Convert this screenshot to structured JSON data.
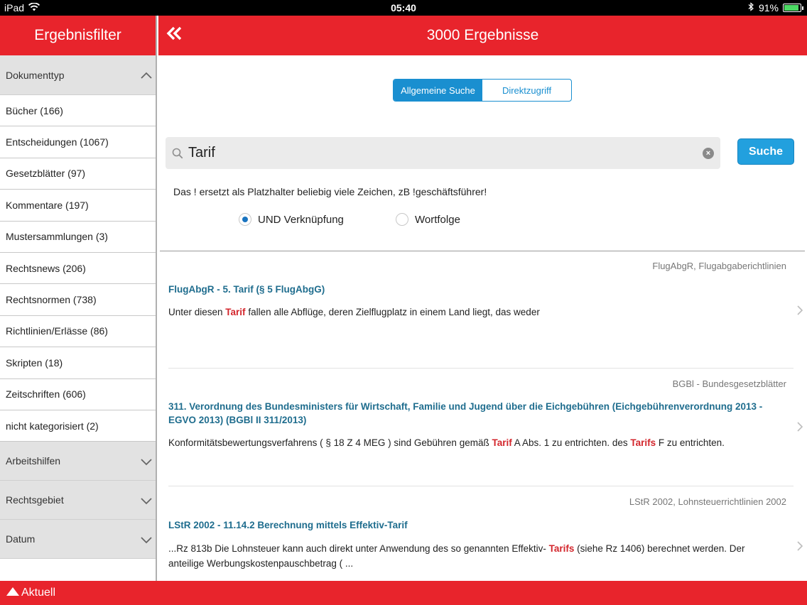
{
  "status": {
    "device": "iPad",
    "time": "05:40",
    "battery": "91%",
    "battery_level": 0.91
  },
  "sidebar": {
    "title": "Ergebnisfilter",
    "document_type": {
      "label": "Dokumenttyp",
      "items": [
        {
          "label": "Bücher (166)"
        },
        {
          "label": "Entscheidungen (1067)"
        },
        {
          "label": "Gesetzblätter (97)"
        },
        {
          "label": "Kommentare (197)"
        },
        {
          "label": "Mustersammlungen (3)"
        },
        {
          "label": "Rechtsnews (206)"
        },
        {
          "label": "Rechtsnormen (738)"
        },
        {
          "label": "Richtlinien/Erlässe (86)"
        },
        {
          "label": "Skripten (18)"
        },
        {
          "label": "Zeitschriften (606)"
        },
        {
          "label": "nicht kategorisiert (2)"
        }
      ]
    },
    "sections": [
      {
        "label": "Arbeitshilfen"
      },
      {
        "label": "Rechtsgebiet"
      },
      {
        "label": "Datum"
      }
    ]
  },
  "main": {
    "title": "3000 Ergebnisse",
    "tabs": [
      {
        "label": "Allgemeine Suche",
        "active": true
      },
      {
        "label": "Direktzugriff",
        "active": false
      }
    ],
    "search": {
      "value": "Tarif",
      "button_label": "Suche",
      "hint": "Das ! ersetzt als Platzhalter beliebig viele Zeichen, zB !geschäftsführer!"
    },
    "options": [
      {
        "label": "UND Verknüpfung",
        "selected": true
      },
      {
        "label": "Wortfolge",
        "selected": false
      }
    ],
    "results": [
      {
        "source": "FlugAbgR, Flugabgaberichtlinien",
        "title": "FlugAbgR - 5. Tarif (§ 5 FlugAbgG)",
        "snippet": [
          {
            "text": "Unter diesen "
          },
          {
            "text": "Tarif",
            "hl": true
          },
          {
            "text": " fallen alle Abflüge, deren Zielflugplatz in einem Land liegt, das weder"
          }
        ]
      },
      {
        "source": "BGBl - Bundesgesetzblätter",
        "title": "311. Verordnung des Bundesministers für Wirtschaft, Familie und Jugend über die Eichgebühren (Eichgebührenverordnung 2013 - EGVO 2013) (BGBl II 311/2013)",
        "snippet": [
          {
            "text": "Konformitätsbewertungsverfahrens ( § 18 Z 4 MEG ) sind Gebühren gemäß "
          },
          {
            "text": "Tarif",
            "hl": true
          },
          {
            "text": " A Abs. 1 zu entrichten. des "
          },
          {
            "text": "Tarifs",
            "hl": true
          },
          {
            "text": " F zu entrichten."
          }
        ]
      },
      {
        "source": "LStR 2002, Lohnsteuerrichtlinien 2002",
        "title": "LStR 2002 - 11.14.2 Berechnung mittels Effektiv-Tarif",
        "snippet": [
          {
            "text": "...Rz 813b Die Lohnsteuer kann auch direkt unter Anwendung des so genannten Effektiv- "
          },
          {
            "text": "Tarifs",
            "hl": true
          },
          {
            "text": " (siehe Rz 1406) berechnet werden. Der anteilige Werbungskostenpauschbetrag ( ..."
          }
        ]
      }
    ]
  },
  "footer": {
    "label": "Aktuell"
  },
  "colors": {
    "brand_red": "#e8242c",
    "accent_blue": "#1a8fd0",
    "title_blue": "#1f6d8e",
    "highlight_red": "#d3262c"
  }
}
